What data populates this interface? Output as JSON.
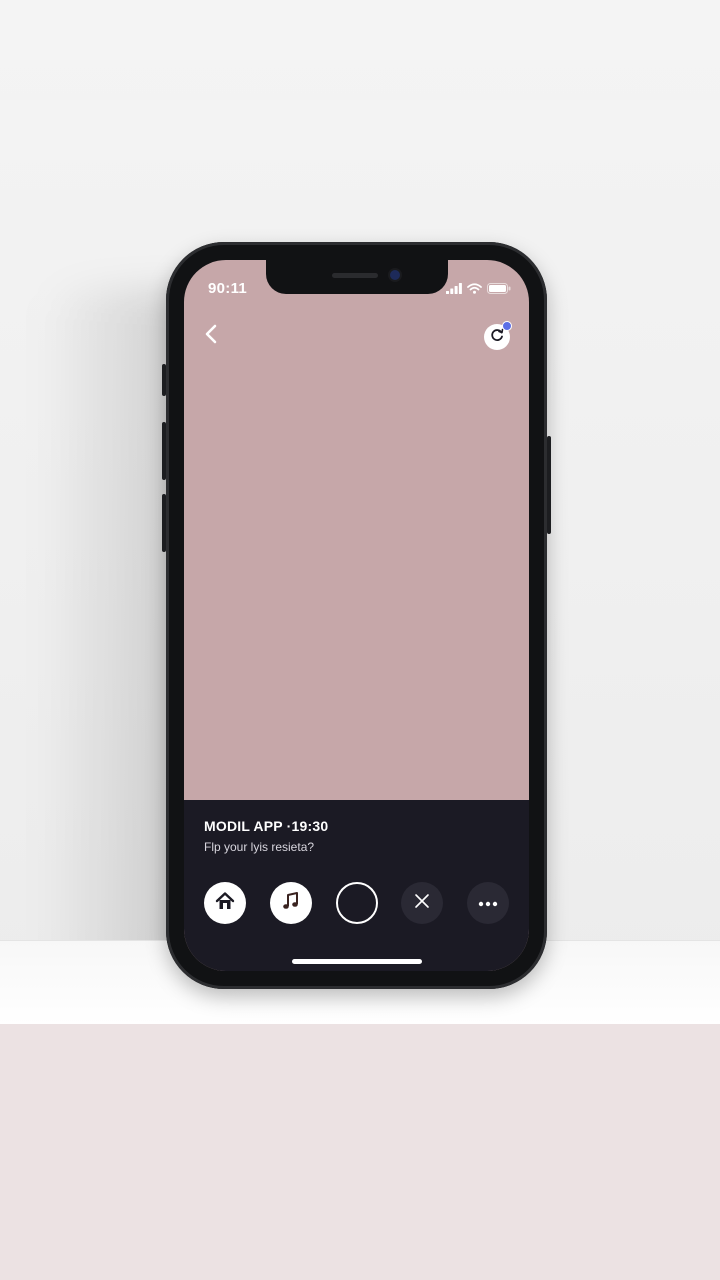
{
  "status_bar": {
    "time": "90:11",
    "signal_icon": "cellular-signal-icon",
    "wifi_icon": "wifi-icon",
    "battery_icon": "battery-icon"
  },
  "top_bar": {
    "back_icon": "chevron-left-icon",
    "action_icon": "refresh-icon",
    "action_badge_color": "#5b6ee6"
  },
  "screen": {
    "background_color": "#c6a7a9"
  },
  "panel": {
    "title": "MODIL APP ·19:30",
    "subtitle": "Flp your lyis resieta?",
    "background_color": "#1b1a24"
  },
  "controls": [
    {
      "icon": "home-icon",
      "style": "white"
    },
    {
      "icon": "music-note-icon",
      "style": "white"
    },
    {
      "icon": "capture-ring-icon",
      "style": "ring"
    },
    {
      "icon": "close-icon",
      "style": "dark"
    },
    {
      "icon": "more-dots-icon",
      "style": "dark"
    }
  ]
}
